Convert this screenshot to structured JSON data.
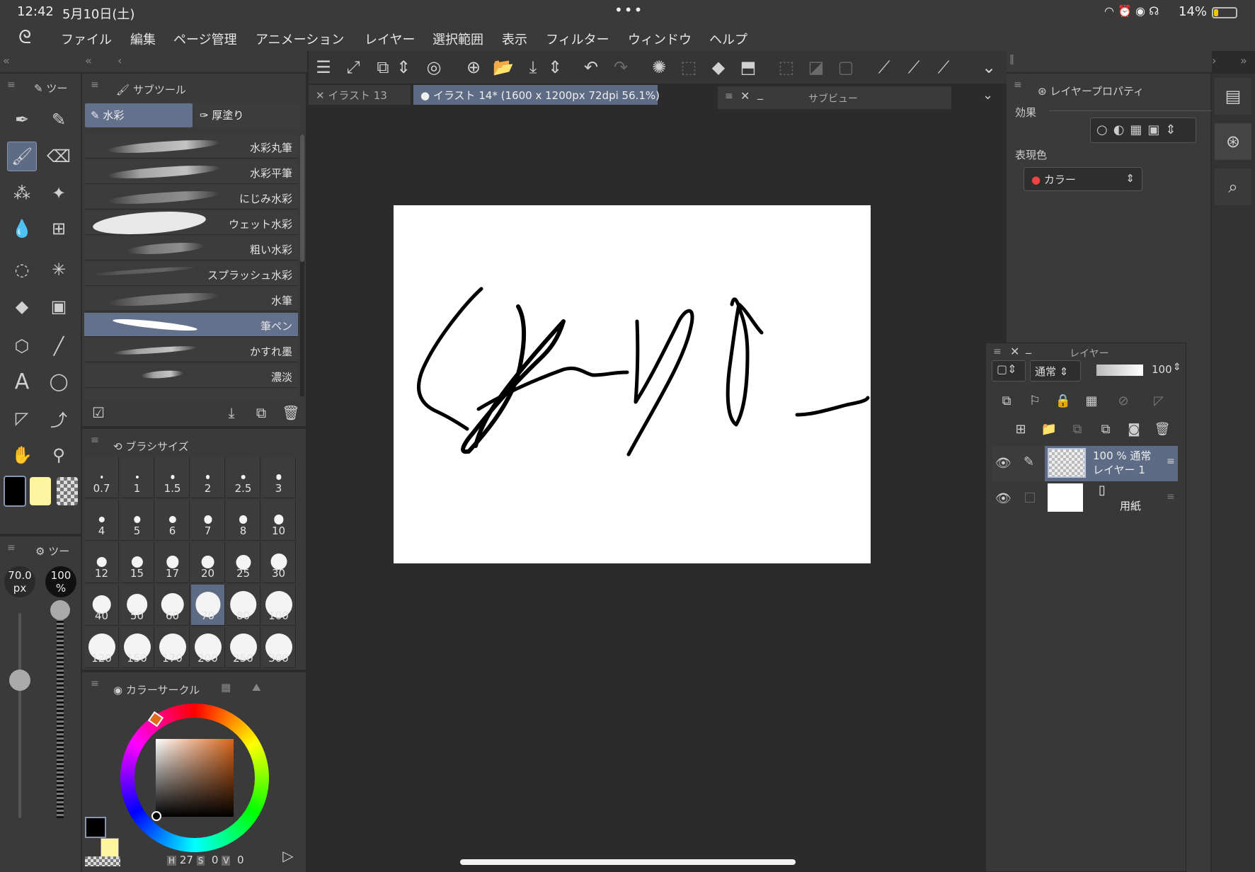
{
  "status": {
    "time": "12:42",
    "date": "5月10日(土)",
    "dots": "•••",
    "battery": "14%"
  },
  "menu": [
    "ファイル",
    "編集",
    "ページ管理",
    "アニメーション",
    "レイヤー",
    "選択範囲",
    "表示",
    "フィルター",
    "ウィンドウ",
    "ヘルプ"
  ],
  "tool_panel": {
    "header": "ツー"
  },
  "subtool": {
    "header": "サブツール",
    "tabs": [
      "水彩",
      "厚塗り"
    ],
    "brushes": [
      "水彩丸筆",
      "水彩平筆",
      "にじみ水彩",
      "ウェット水彩",
      "粗い水彩",
      "スプラッシュ水彩",
      "水筆",
      "筆ペン",
      "かすれ墨",
      "濃淡"
    ],
    "selected_brush": "筆ペン"
  },
  "brush_size": {
    "header": "ブラシサイズ",
    "sizes": [
      "0.7",
      "1",
      "1.5",
      "2",
      "2.5",
      "3",
      "4",
      "5",
      "6",
      "7",
      "8",
      "10",
      "12",
      "15",
      "17",
      "20",
      "25",
      "30",
      "40",
      "50",
      "60",
      "70",
      "80",
      "100",
      "120",
      "150",
      "170",
      "200",
      "250",
      "300"
    ],
    "selected": "70"
  },
  "tool_property": {
    "header": "ツー",
    "size_value": "70.0",
    "size_unit": "px",
    "opacity_value": "100",
    "opacity_unit": "%"
  },
  "color_circle": {
    "header": "カラーサークル",
    "h_label": "H",
    "h_value": "27",
    "s_label": "S",
    "s_value": "0",
    "v_label": "V",
    "v_value": "0",
    "main_color": "#000000",
    "sub_color": "#fff5a0"
  },
  "tabs": [
    {
      "label": "イラスト 13",
      "active": false
    },
    {
      "label": "イラスト 14* (1600 x 1200px 72dpi 56.1%)",
      "active": true
    }
  ],
  "subview": {
    "title": "サブビュー"
  },
  "layer_property": {
    "header": "レイヤープロパティ",
    "effect_label": "効果",
    "expression_label": "表現色",
    "expression_value": "カラー"
  },
  "layers": {
    "header": "レイヤー",
    "blend_mode": "通常",
    "opacity": "100",
    "items": [
      {
        "line1": "100 % 通常",
        "line2": "レイヤー 1",
        "selected": true
      },
      {
        "line1": "",
        "line2": "用紙",
        "selected": false
      }
    ]
  }
}
